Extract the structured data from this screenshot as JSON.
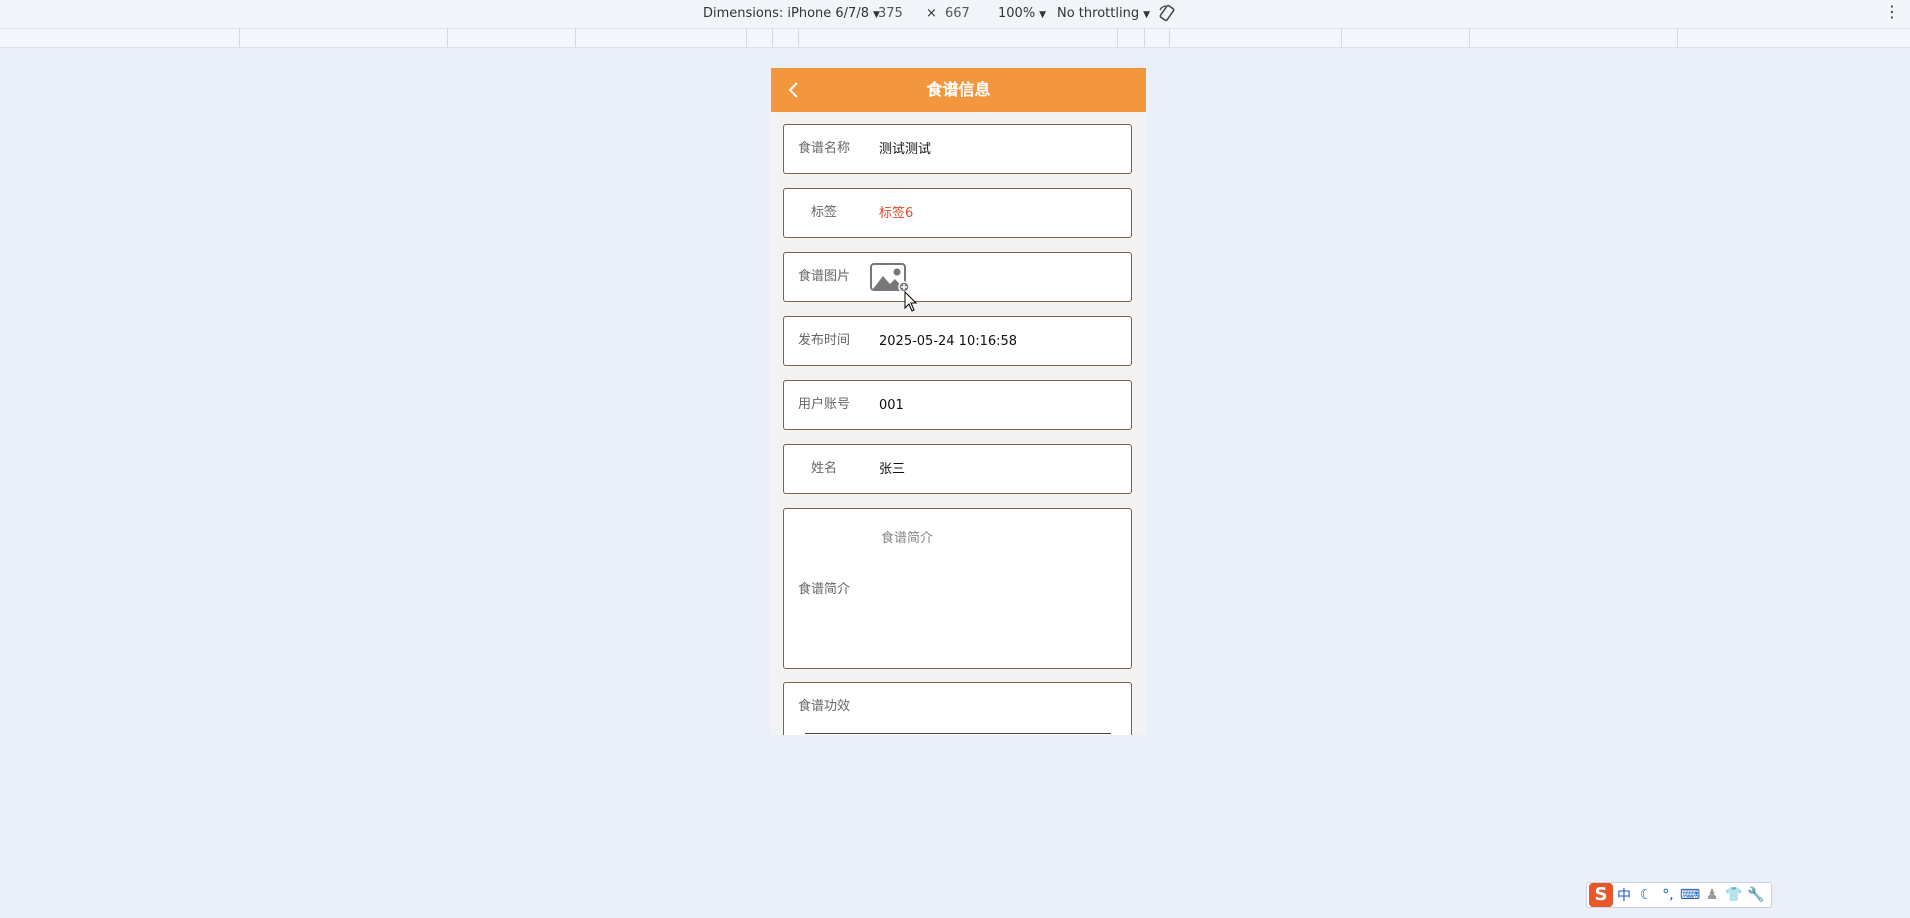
{
  "devtools": {
    "device_label": "Dimensions: iPhone 6/7/8",
    "width": "375",
    "times": "×",
    "height": "667",
    "zoom": "100%",
    "throttling": "No throttling"
  },
  "page": {
    "title": "食谱信息",
    "fields": {
      "name": {
        "label": "食谱名称",
        "value": "测试测试"
      },
      "tag": {
        "label": "标签",
        "value": "标签6"
      },
      "image": {
        "label": "食谱图片"
      },
      "publish_time": {
        "label": "发布时间",
        "value": "2025-05-24 10:16:58"
      },
      "account": {
        "label": "用户账号",
        "value": "001"
      },
      "fullname": {
        "label": "姓名",
        "value": "张三"
      },
      "intro": {
        "label": "食谱简介",
        "placeholder": "食谱简介"
      },
      "effect": {
        "label": "食谱功效"
      }
    }
  },
  "ime": {
    "logo": "S",
    "lang": "中"
  },
  "colors": {
    "nav_bg": "#f2973e",
    "tag_red": "#e04a2f",
    "row_border": "#7a6446"
  }
}
